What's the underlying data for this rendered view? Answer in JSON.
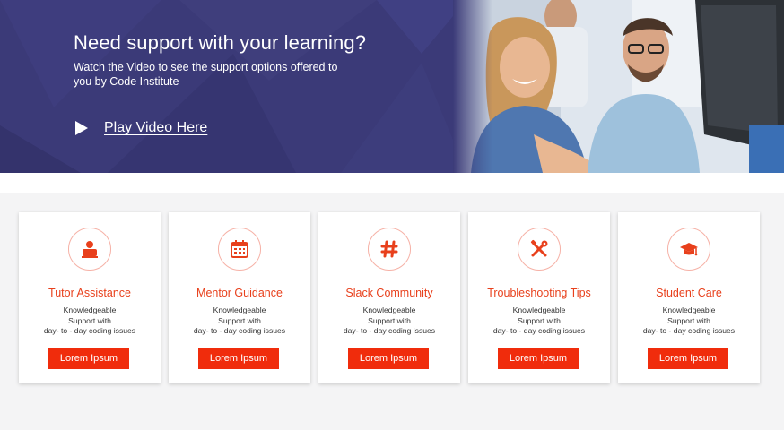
{
  "hero": {
    "title": "Need support with your learning?",
    "subtitle": "Watch the Video to see the support options offered to you by Code Institute",
    "play_label": "Play Video Here"
  },
  "colors": {
    "hero_bg": "#3b3a78",
    "accent": "#e8401c",
    "button": "#f02c0c"
  },
  "cards": [
    {
      "icon": "tutor-icon",
      "title": "Tutor Assistance",
      "desc1": "Knowledgeable",
      "desc2": "Support with",
      "desc3": "day- to - day coding issues",
      "button": "Lorem Ipsum"
    },
    {
      "icon": "calendar-icon",
      "title": "Mentor Guidance",
      "desc1": "Knowledgeable",
      "desc2": "Support with",
      "desc3": "day- to - day coding issues",
      "button": "Lorem Ipsum"
    },
    {
      "icon": "hashtag-icon",
      "title": "Slack Community",
      "desc1": "Knowledgeable",
      "desc2": "Support with",
      "desc3": "day- to - day coding issues",
      "button": "Lorem Ipsum"
    },
    {
      "icon": "tools-icon",
      "title": "Troubleshooting Tips",
      "desc1": "Knowledgeable",
      "desc2": "Support with",
      "desc3": "day- to - day coding issues",
      "button": "Lorem Ipsum"
    },
    {
      "icon": "graduation-cap-icon",
      "title": "Student Care",
      "desc1": "Knowledgeable",
      "desc2": "Support with",
      "desc3": "day- to - day coding issues",
      "button": "Lorem Ipsum"
    }
  ]
}
